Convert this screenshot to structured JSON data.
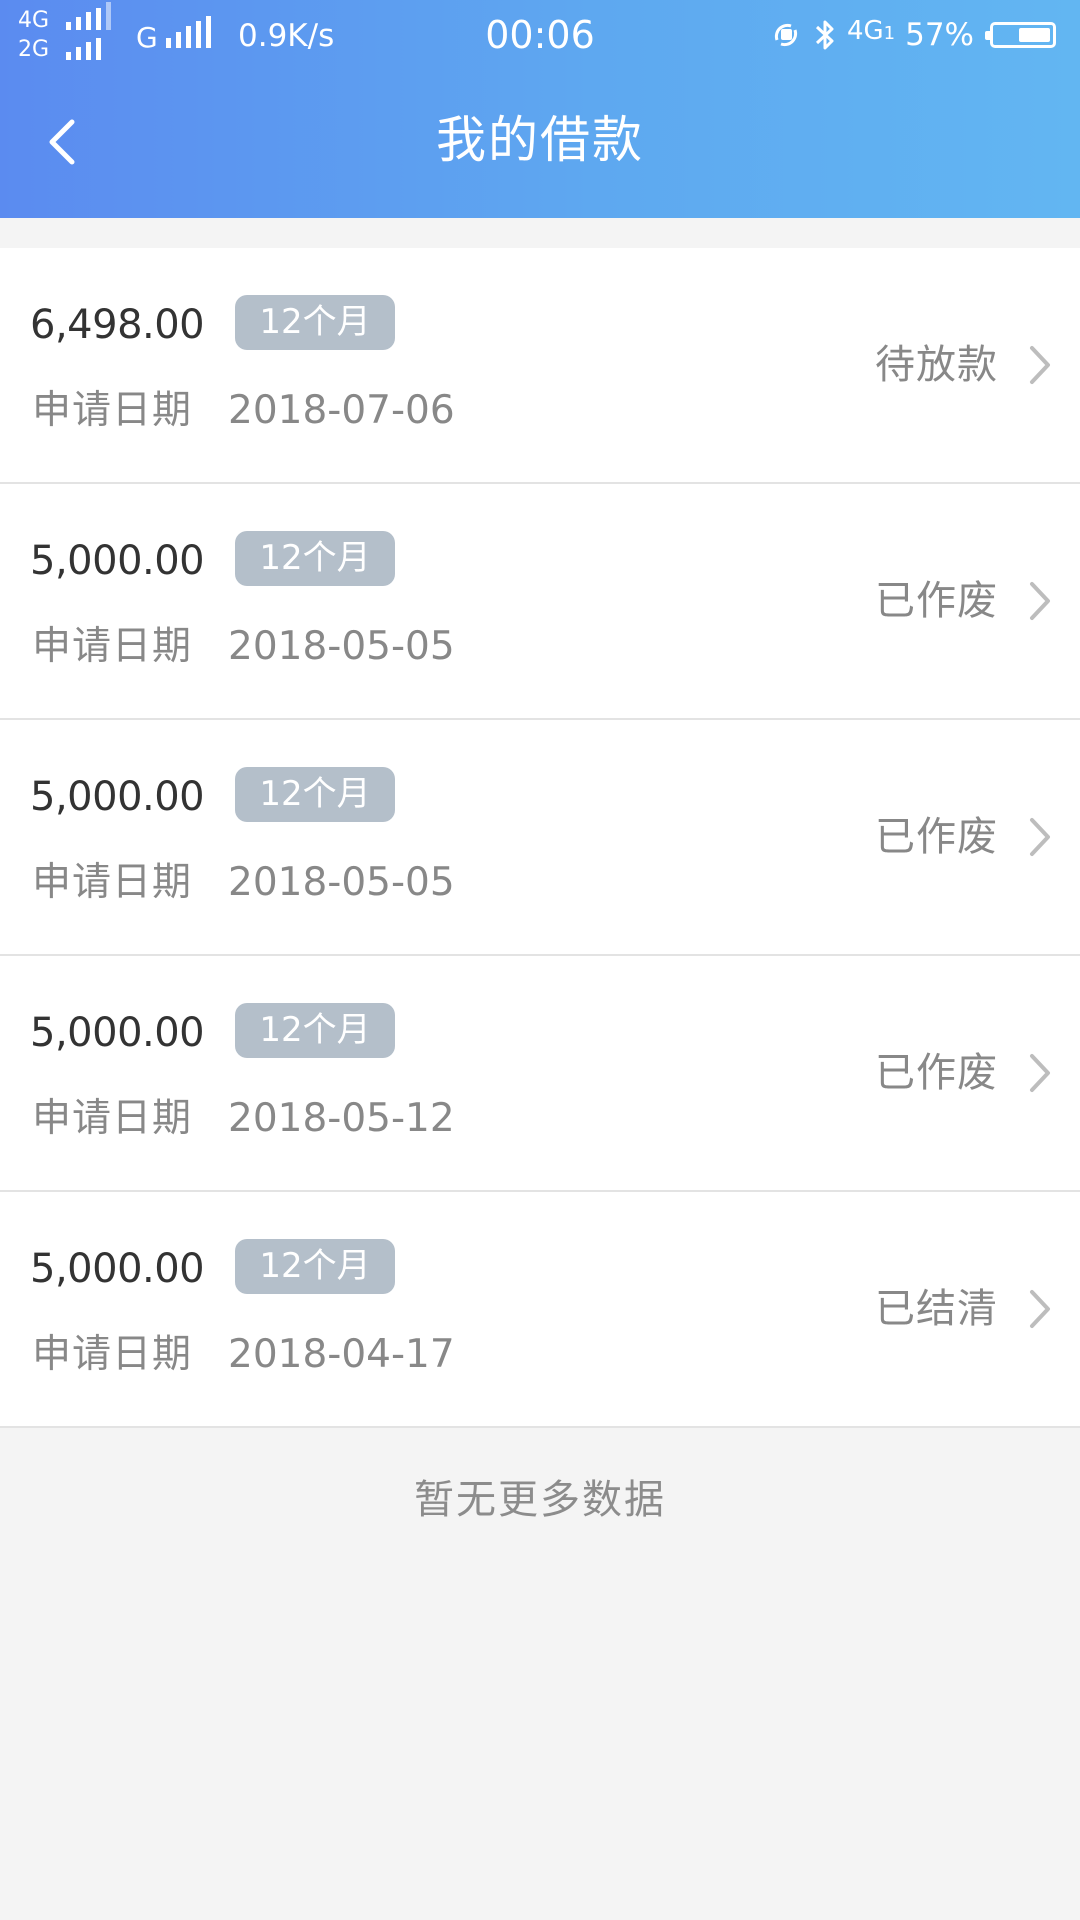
{
  "status_bar": {
    "net_top": "4G",
    "net_bottom": "2G",
    "net_g": "G",
    "speed": "0.9K/s",
    "time": "00:06",
    "net_right": "4G",
    "net_right_suffix": "1",
    "battery": "57%",
    "battery_level": 0.57
  },
  "header": {
    "title": "我的借款"
  },
  "loans": [
    {
      "amount": "6,498.00",
      "term": "12个月",
      "date_label": "申请日期",
      "date": "2018-07-06",
      "status": "待放款"
    },
    {
      "amount": "5,000.00",
      "term": "12个月",
      "date_label": "申请日期",
      "date": "2018-05-05",
      "status": "已作废"
    },
    {
      "amount": "5,000.00",
      "term": "12个月",
      "date_label": "申请日期",
      "date": "2018-05-05",
      "status": "已作废"
    },
    {
      "amount": "5,000.00",
      "term": "12个月",
      "date_label": "申请日期",
      "date": "2018-05-12",
      "status": "已作废"
    },
    {
      "amount": "5,000.00",
      "term": "12个月",
      "date_label": "申请日期",
      "date": "2018-04-17",
      "status": "已结清"
    }
  ],
  "footer": {
    "no_more": "暂无更多数据"
  },
  "colors": {
    "header_start": "#5b8bf0",
    "header_end": "#62b6f2",
    "badge": "#b4bfca",
    "background": "#f4f4f4"
  },
  "icons": {
    "back": "chevron-left-icon",
    "row_arrow": "chevron-right-icon"
  }
}
